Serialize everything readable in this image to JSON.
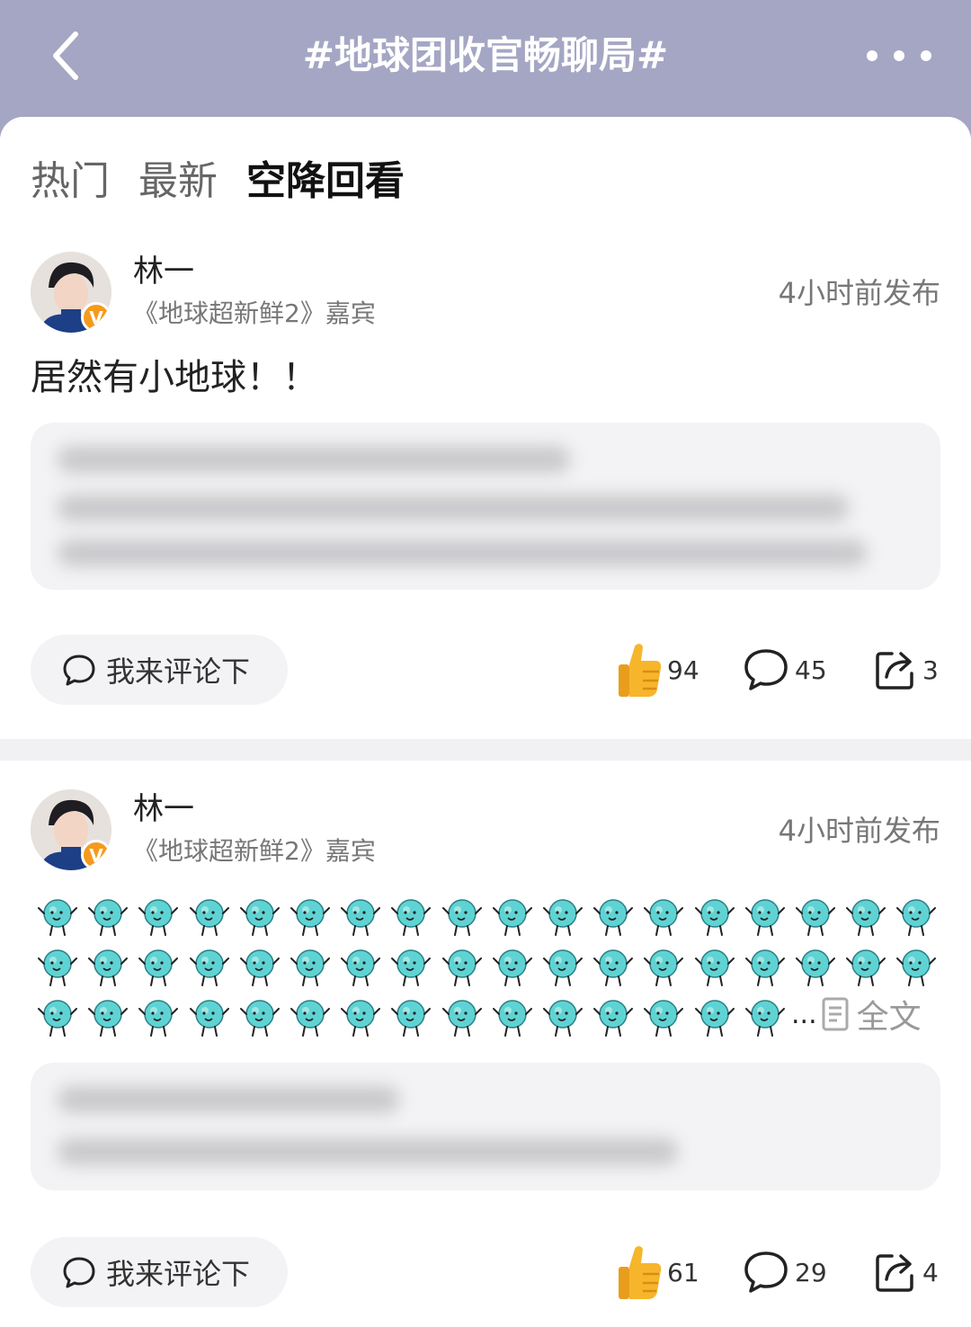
{
  "header": {
    "title": "#地球团收官畅聊局#"
  },
  "tabs": [
    {
      "label": "热门",
      "active": false
    },
    {
      "label": "最新",
      "active": false
    },
    {
      "label": "空降回看",
      "active": true
    }
  ],
  "posts": [
    {
      "author": "林一",
      "subtitle": "《地球超新鲜2》嘉宾",
      "time": "4小时前发布",
      "text": "居然有小地球！！",
      "comment_placeholder": "我来评论下",
      "likes": "94",
      "comments": "45",
      "shares": "3"
    },
    {
      "author": "林一",
      "subtitle": "《地球超新鲜2》嘉宾",
      "time": "4小时前发布",
      "ellipsis": "...",
      "full_text_label": "全文",
      "comment_placeholder": "我来评论下",
      "likes": "61",
      "comments": "29",
      "shares": "4"
    }
  ],
  "colors": {
    "header_bg": "#a4a6c4",
    "verified_badge": "#f59a1b",
    "emoji_body": "#5fd3d3",
    "thumb": "#f7b52c"
  },
  "icons": {
    "back": "chevron-left-icon",
    "more": "more-dots-icon",
    "comment": "speech-bubble-icon",
    "like": "thumbs-up-icon",
    "share": "share-icon",
    "document": "document-icon",
    "emoji": "little-earth-emoji-icon"
  }
}
